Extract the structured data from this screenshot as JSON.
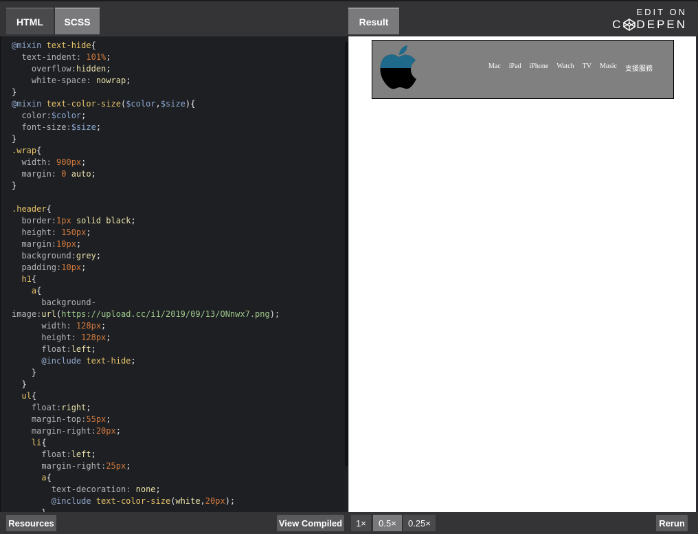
{
  "tabs": {
    "html": "HTML",
    "scss": "SCSS",
    "result": "Result"
  },
  "codepen": {
    "edit_on": "EDIT ON",
    "name_c": "C",
    "name_rest": "DEPEN"
  },
  "code": {
    "l1": [
      "@mixin",
      " text-hide",
      "{"
    ],
    "l2": [
      "  text-indent: ",
      "101%",
      ";"
    ],
    "l3": [
      "    overflow:",
      "hidden",
      ";"
    ],
    "l4": [
      "    white-space: ",
      "nowrap",
      ";"
    ],
    "l5": [
      "}"
    ],
    "l6": [
      "@mixin",
      " text-color-size",
      "(",
      "$color",
      ",",
      "$size",
      "){"
    ],
    "l7": [
      "  color:",
      "$color",
      ";"
    ],
    "l8": [
      "  font-size:",
      "$size",
      ";"
    ],
    "l9": [
      "}"
    ],
    "l10": [
      ".wrap",
      "{"
    ],
    "l11": [
      "  width: ",
      "900px",
      ";"
    ],
    "l12": [
      "  margin: ",
      "0",
      " auto",
      ";"
    ],
    "l13": [
      "}"
    ],
    "l14": [
      ".header",
      "{"
    ],
    "l15": [
      "  border:",
      "1px",
      " solid black",
      ";"
    ],
    "l16": [
      "  height: ",
      "150px",
      ";"
    ],
    "l17": [
      "  margin:",
      "10px",
      ";"
    ],
    "l18": [
      "  background:",
      "grey",
      ";"
    ],
    "l19": [
      "  padding:",
      "10px",
      ";"
    ],
    "l20": [
      "  h1",
      "{"
    ],
    "l21": [
      "    a",
      "{"
    ],
    "l22": [
      "      background-"
    ],
    "l23": [
      "image:",
      "url",
      "(",
      "https://upload.cc/i1/2019/09/13/ONnwx7.png",
      ");"
    ],
    "l24": [
      "      width: ",
      "128px",
      ";"
    ],
    "l25": [
      "      height: ",
      "128px",
      ";"
    ],
    "l26": [
      "      float:",
      "left",
      ";"
    ],
    "l27": [
      "      @include",
      " text-hide",
      ";"
    ],
    "l28": [
      "    }"
    ],
    "l29": [
      "  }"
    ],
    "l30": [
      "  ul",
      "{"
    ],
    "l31": [
      "    float:",
      "right",
      ";"
    ],
    "l32": [
      "    margin-top:",
      "55px",
      ";"
    ],
    "l33": [
      "    margin-right:",
      "20px",
      ";"
    ],
    "l34": [
      "    li",
      "{"
    ],
    "l35": [
      "      float:",
      "left",
      ";"
    ],
    "l36": [
      "      margin-right:",
      "25px",
      ";"
    ],
    "l37": [
      "      a",
      "{"
    ],
    "l38": [
      "        text-decoration: ",
      "none",
      ";"
    ],
    "l39": [
      "        @include",
      " text-color-size",
      "(",
      "white",
      ",",
      "20px",
      ");"
    ],
    "l40": [
      "      }"
    ]
  },
  "result": {
    "nav": [
      "Mac",
      "iPad",
      "iPhone",
      "Watch",
      "TV",
      "Music",
      "支援服務"
    ],
    "colors": {
      "header_bg": "#808080",
      "apple_blue": "#1f6a8a",
      "apple_black": "#000000"
    }
  },
  "bottom": {
    "resources": "Resources",
    "view_compiled": "View Compiled",
    "zoom_1": "1×",
    "zoom_05": "0.5×",
    "zoom_025": "0.25×",
    "rerun": "Rerun"
  }
}
